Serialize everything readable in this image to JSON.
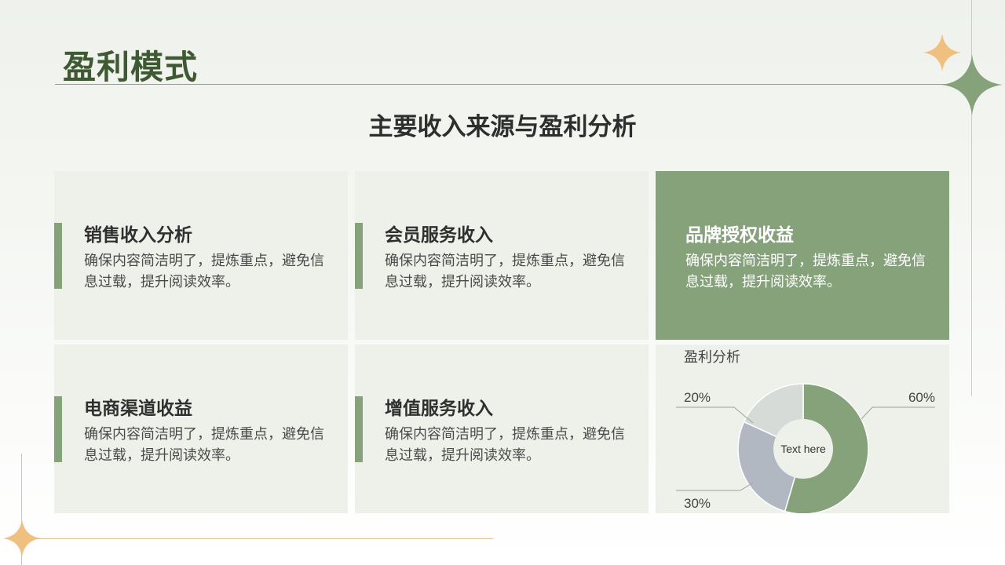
{
  "page": {
    "title": "盈利模式",
    "subtitle": "主要收入来源与盈利分析"
  },
  "cards": [
    {
      "title": "销售收入分析",
      "body": "确保内容简洁明了，提炼重点，避免信息过载，提升阅读效率。"
    },
    {
      "title": "会员服务收入",
      "body": "确保内容简洁明了，提炼重点，避免信息过载，提升阅读效率。"
    },
    {
      "title": "品牌授权收益",
      "body": "确保内容简洁明了，提炼重点，避免信息过载，提升阅读效率。"
    },
    {
      "title": "电商渠道收益",
      "body": "确保内容简洁明了，提炼重点，避免信息过载，提升阅读效率。"
    },
    {
      "title": "增值服务收入",
      "body": "确保内容简洁明了，提炼重点，避免信息过载，提升阅读效率。"
    }
  ],
  "colors": {
    "accent_green": "#86a27b",
    "title_green": "#3f5a33",
    "sparkle_gold": "#f0c081",
    "sparkle_green": "#86a27b",
    "slice_gray_blue": "#b1b8c2",
    "slice_light_gray": "#d6dbd8"
  },
  "icons": [
    "sparkle-icon"
  ],
  "chart_data": {
    "type": "pie",
    "title": "盈利分析",
    "center_label": "Text here",
    "values": [
      60,
      30,
      20
    ],
    "labels": [
      "60%",
      "30%",
      "20%"
    ],
    "colors": [
      "#86a27b",
      "#b1b8c2",
      "#d6dbd8"
    ]
  }
}
